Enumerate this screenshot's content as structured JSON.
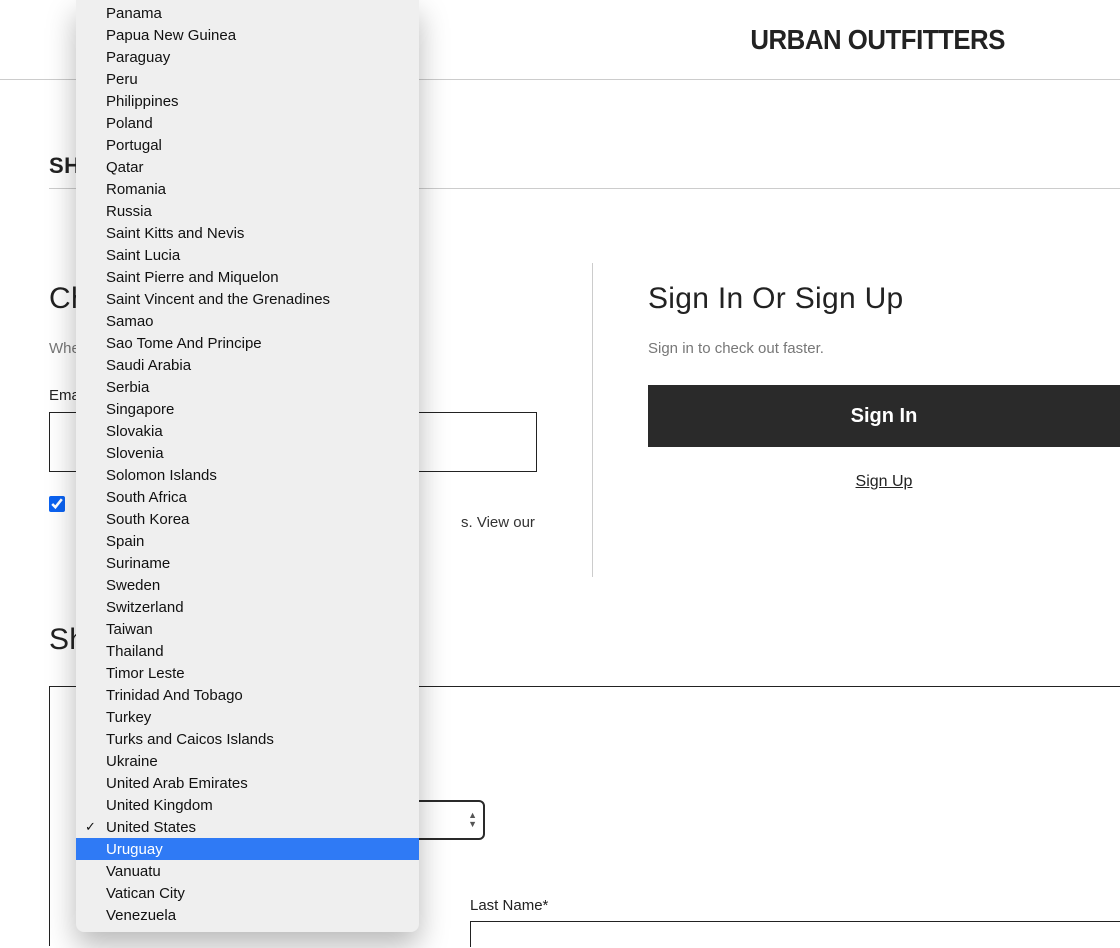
{
  "header": {
    "logo": "URBAN OUTFITTERS"
  },
  "section_label_prefix": "SH",
  "left": {
    "heading_prefix": "Ch",
    "helper_prefix": "Whe",
    "email_label_prefix": "Ema",
    "checkbox_text_prefix": "",
    "checkbox_tail": "s. View our"
  },
  "right": {
    "heading": "Sign In Or Sign Up",
    "helper": "Sign in to check out faster.",
    "signin_label": "Sign In",
    "signup_label": "Sign Up"
  },
  "ship": {
    "heading_prefix": "Sh",
    "lastname_label": "Last Name*"
  },
  "dropdown": {
    "selected": "United States",
    "highlighted": "Uruguay",
    "options": [
      "Panama",
      "Papua New Guinea",
      "Paraguay",
      "Peru",
      "Philippines",
      "Poland",
      "Portugal",
      "Qatar",
      "Romania",
      "Russia",
      "Saint Kitts and Nevis",
      "Saint Lucia",
      "Saint Pierre and Miquelon",
      "Saint Vincent and the Grenadines",
      "Samao",
      "Sao Tome And Principe",
      "Saudi Arabia",
      "Serbia",
      "Singapore",
      "Slovakia",
      "Slovenia",
      "Solomon Islands",
      "South Africa",
      "South Korea",
      "Spain",
      "Suriname",
      "Sweden",
      "Switzerland",
      "Taiwan",
      "Thailand",
      "Timor Leste",
      "Trinidad And Tobago",
      "Turkey",
      "Turks and Caicos Islands",
      "Ukraine",
      "United Arab Emirates",
      "United Kingdom",
      "United States",
      "Uruguay",
      "Vanuatu",
      "Vatican City",
      "Venezuela"
    ]
  }
}
